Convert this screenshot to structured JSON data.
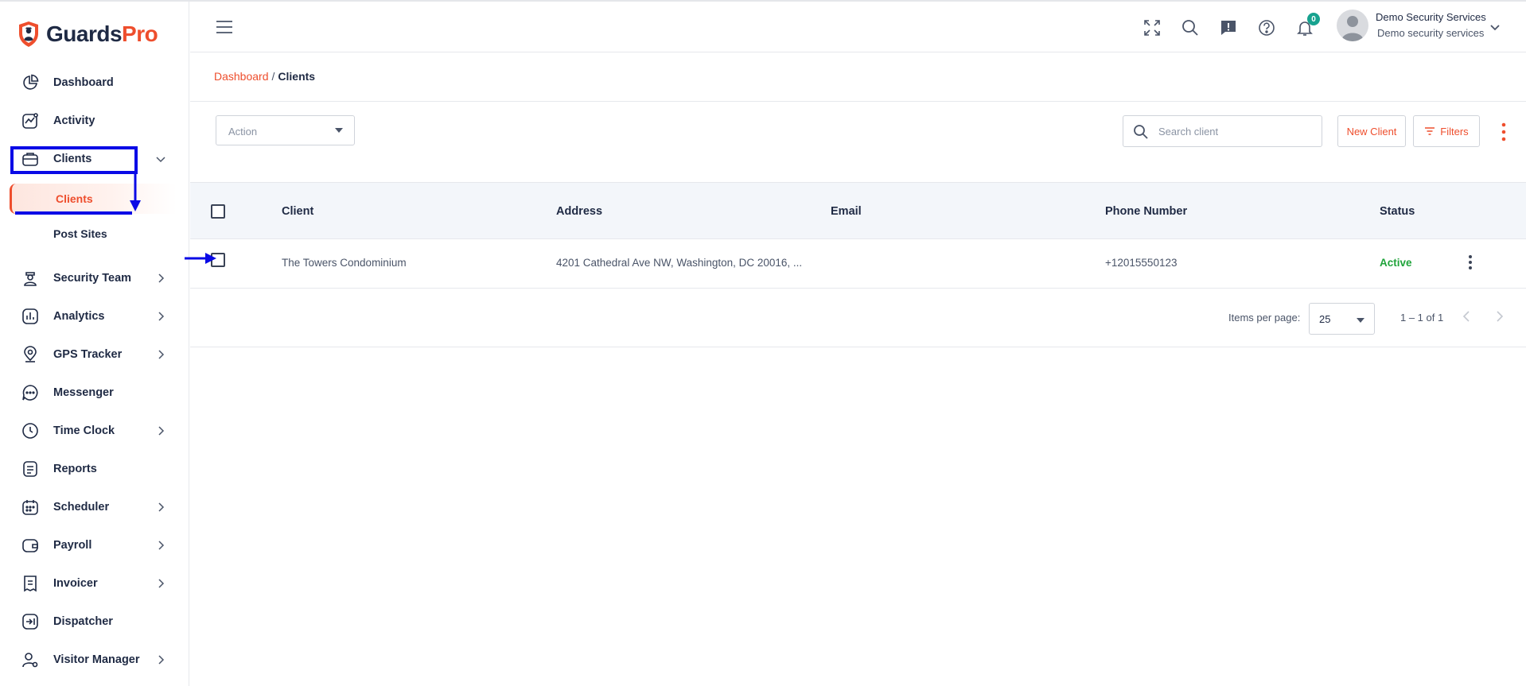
{
  "brand": {
    "name_part1": "Guards",
    "name_part2": "Pro",
    "accent": "#ee4e2d",
    "navy": "#1f2a44"
  },
  "sidebar": {
    "items": [
      {
        "label": "Dashboard",
        "icon": "dashboard-icon",
        "has_chevron": false
      },
      {
        "label": "Activity",
        "icon": "activity-icon",
        "has_chevron": false
      },
      {
        "label": "Clients",
        "icon": "clients-icon",
        "has_chevron": true,
        "expanded": true
      },
      {
        "label": "Security Team",
        "icon": "security-team-icon",
        "has_chevron": true
      },
      {
        "label": "Analytics",
        "icon": "analytics-icon",
        "has_chevron": true
      },
      {
        "label": "GPS Tracker",
        "icon": "gps-tracker-icon",
        "has_chevron": true
      },
      {
        "label": "Messenger",
        "icon": "messenger-icon",
        "has_chevron": false
      },
      {
        "label": "Time Clock",
        "icon": "time-clock-icon",
        "has_chevron": true
      },
      {
        "label": "Reports",
        "icon": "reports-icon",
        "has_chevron": false
      },
      {
        "label": "Scheduler",
        "icon": "scheduler-icon",
        "has_chevron": true
      },
      {
        "label": "Payroll",
        "icon": "payroll-icon",
        "has_chevron": true
      },
      {
        "label": "Invoicer",
        "icon": "invoicer-icon",
        "has_chevron": true
      },
      {
        "label": "Dispatcher",
        "icon": "dispatcher-icon",
        "has_chevron": false
      },
      {
        "label": "Visitor Manager",
        "icon": "visitor-manager-icon",
        "has_chevron": true
      }
    ],
    "subitems": [
      {
        "label": "Clients",
        "active": true
      },
      {
        "label": "Post Sites",
        "active": false
      }
    ]
  },
  "header": {
    "icons": [
      "fullscreen-icon",
      "search-icon",
      "feedback-icon",
      "help-icon",
      "bell-icon"
    ],
    "notification_count": "0",
    "user_name": "Demo Security Services",
    "user_company": "Demo security services"
  },
  "breadcrumb": {
    "home": "Dashboard",
    "separator": "/",
    "current": "Clients"
  },
  "toolbar": {
    "action_placeholder": "Action",
    "search_placeholder": "Search client",
    "new_client_label": "New Client",
    "filters_label": "Filters"
  },
  "table": {
    "columns": [
      "Client",
      "Address",
      "Email",
      "Phone Number",
      "Status"
    ],
    "rows": [
      {
        "client": "The Towers Condominium",
        "address": "4201 Cathedral Ave NW, Washington, DC 20016, ...",
        "email": "",
        "phone": "+12015550123",
        "status": "Active",
        "status_color": "#1fa33a"
      }
    ]
  },
  "pagination": {
    "items_per_page_label": "Items per page:",
    "items_per_page": "25",
    "range": "1 – 1 of 1"
  },
  "annotation_color": "#0a0ae6"
}
